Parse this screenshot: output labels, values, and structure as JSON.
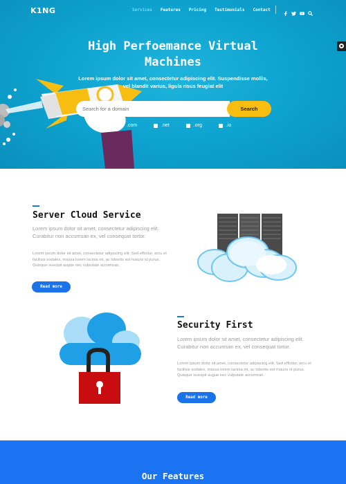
{
  "nav": {
    "logo": "K1NG",
    "menu": [
      "Services",
      "Features",
      "Pricing",
      "Testimonials",
      "Contact"
    ],
    "active": "Services",
    "social_icons": [
      "facebook-icon",
      "twitter-icon",
      "youtube-icon",
      "search-icon"
    ]
  },
  "hero": {
    "title": "High Perfoemance Virtual Machines",
    "subtitle": "Lorem ipsum dolor sit amet, consectetur adipiscing elit. Suspendisse mollis, vel blandit varius, ligula risus feugiat elit",
    "search_placeholder": "Search for a domain",
    "search_button": "Search",
    "tlds": [
      ".com",
      ".net",
      ".org",
      ".io"
    ]
  },
  "sections": [
    {
      "title": "Server Cloud Service",
      "lead": "Lorem ipsum dolor sit amet, consectetur adipiscing elit. Curabitur non accumsan ex, vel consequat tortor.",
      "body": "Lorem ipsum dolor sit amet, consectetur adipiscing elit. Sed efficitur, arcu et facilisis sodales, massa lorem lacinia mi, ac lobortis est mauris id purus. Quisque suscipit augue nec vulputate accumsan.",
      "button": "Read more"
    },
    {
      "title": "Security First",
      "lead": "Lorem ipsum dolor sit amet, consectetur adipiscing elit. Curabitur non accumsan ex, vel consequat tortor.",
      "body": "Lorem ipsum dolor sit amet, consectetur adipiscing elit. Sed efficitur, arcu et facilisis sodales, massa lorem lacinia mi, ac lobortis est mauris id purus. Quisque suscipit augue nec vulputate accumsan.",
      "button": "Read more"
    }
  ],
  "features": {
    "title": "Our Features"
  },
  "colors": {
    "hero": "#0ea3cf",
    "accent": "#1a73e8",
    "search_button": "#f7bd10",
    "features_band": "#1a73f0"
  }
}
